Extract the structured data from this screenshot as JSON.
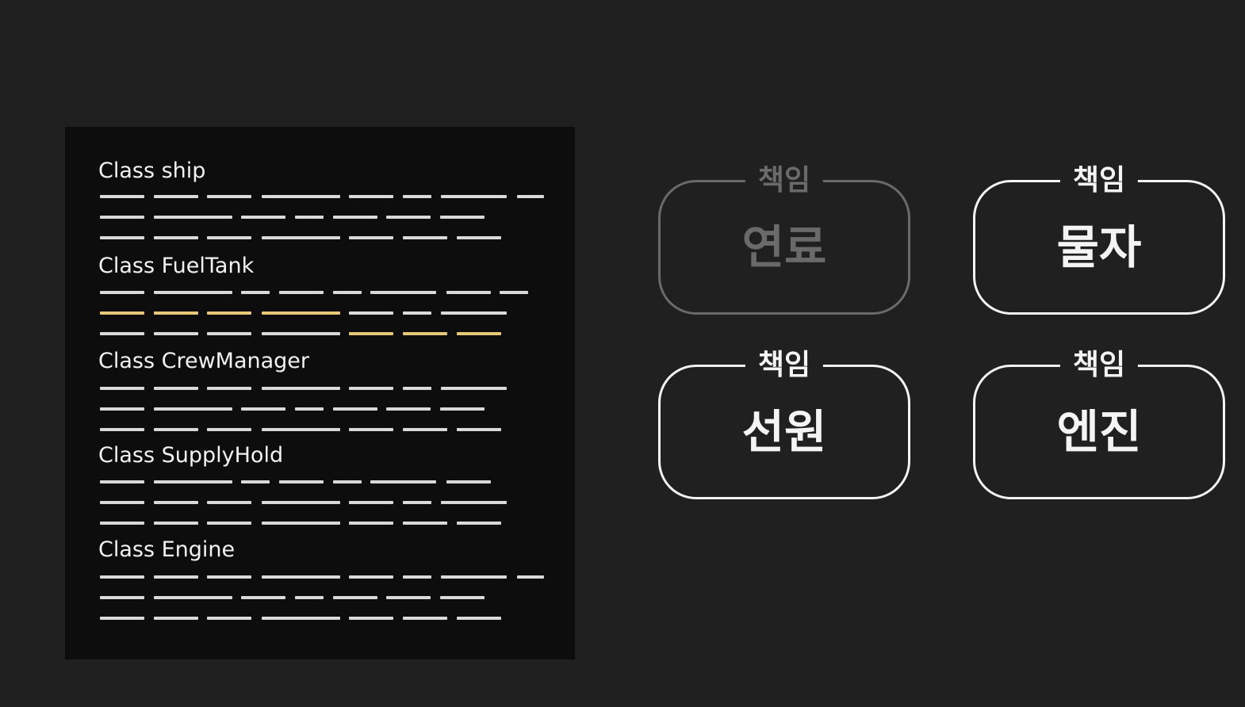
{
  "code_panel": {
    "classes": [
      {
        "label": "Class ship"
      },
      {
        "label": "Class FuelTank"
      },
      {
        "label": "Class CrewManager"
      },
      {
        "label": "Class SupplyHold"
      },
      {
        "label": "Class Engine"
      }
    ]
  },
  "responsibilities": [
    {
      "tag": "책임",
      "title": "연료",
      "dimmed": true
    },
    {
      "tag": "책임",
      "title": "물자",
      "dimmed": false
    },
    {
      "tag": "책임",
      "title": "선원",
      "dimmed": false
    },
    {
      "tag": "책임",
      "title": "엔진",
      "dimmed": false
    }
  ],
  "colors": {
    "background": "#202020",
    "panel": "#0d0d0d",
    "code_line": "#d9d9d9",
    "highlight": "#e8c874",
    "card_border": "#f4f4f4",
    "card_dim": "#6a6a6a"
  }
}
